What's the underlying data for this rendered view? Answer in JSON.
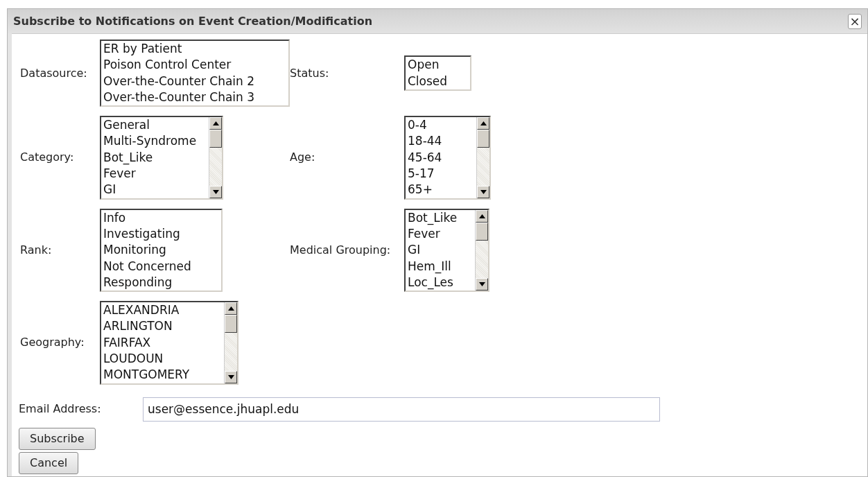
{
  "dialog": {
    "title": "Subscribe to Notifications on Event Creation/Modification",
    "close": "×"
  },
  "rows": [
    {
      "left": {
        "label": "Datasource:",
        "scrollbar": false,
        "items": [
          "ER by Patient",
          "Poison Control Center",
          "Over-the-Counter Chain 2",
          "Over-the-Counter Chain 3"
        ]
      },
      "right": {
        "label": "Status:",
        "scrollbar": false,
        "items": [
          "Open",
          "Closed"
        ]
      }
    },
    {
      "left": {
        "label": "Category:",
        "scrollbar": true,
        "items": [
          "General",
          "Multi-Syndrome",
          "Bot_Like",
          "Fever",
          "GI"
        ]
      },
      "right": {
        "label": "Age:",
        "scrollbar": true,
        "items": [
          "0-4",
          "18-44",
          "45-64",
          "5-17",
          "65+"
        ]
      }
    },
    {
      "left": {
        "label": "Rank:",
        "scrollbar": false,
        "items": [
          "Info",
          "Investigating",
          "Monitoring",
          "Not Concerned",
          "Responding"
        ]
      },
      "right": {
        "label": "Medical Grouping:",
        "scrollbar": true,
        "items": [
          "Bot_Like",
          "Fever",
          "GI",
          "Hem_Ill",
          "Loc_Les"
        ]
      }
    },
    {
      "left": {
        "label": "Geography:",
        "scrollbar": true,
        "items": [
          "ALEXANDRIA",
          "ARLINGTON",
          "FAIRFAX",
          "LOUDOUN",
          "MONTGOMERY"
        ]
      }
    }
  ],
  "email": {
    "label": "Email Address:",
    "value": "user@essence.jhuapl.edu"
  },
  "buttons": [
    "Subscribe",
    "Cancel"
  ]
}
